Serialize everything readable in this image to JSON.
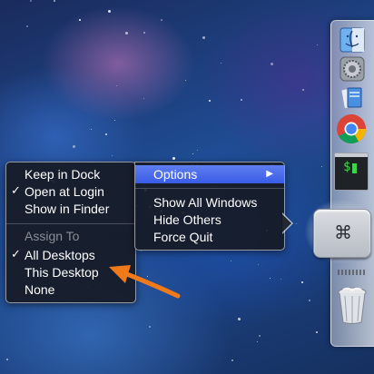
{
  "menu": {
    "items": [
      {
        "label": "Keep in Dock",
        "checked": false,
        "disabled": false
      },
      {
        "label": "Open at Login",
        "checked": true,
        "disabled": false
      },
      {
        "label": "Show in Finder",
        "checked": false,
        "disabled": false
      }
    ],
    "assign_header": "Assign To",
    "assign_items": [
      {
        "label": "All Desktops",
        "checked": true
      },
      {
        "label": "This Desktop",
        "checked": false
      },
      {
        "label": "None",
        "checked": false
      }
    ],
    "check_glyph": "✓"
  },
  "options_menu": {
    "label": "Options",
    "arrow": "▶",
    "items": [
      "Show All Windows",
      "Hide Others",
      "Force Quit"
    ]
  },
  "dock": {
    "apps": [
      "finder-icon",
      "system-preferences-icon",
      "files-icon",
      "chrome-icon",
      "terminal-icon",
      "keyboard-command-icon",
      "trash-icon"
    ],
    "terminal_prompt": "$",
    "key_glyph": "⌘"
  },
  "colors": {
    "highlight": "#3a5ce6",
    "menu_bg": "#161a22",
    "annotation_arrow": "#f07a1a"
  }
}
